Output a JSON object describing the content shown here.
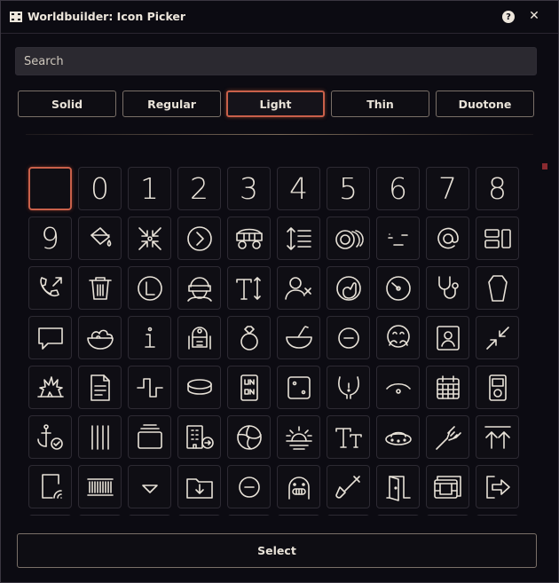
{
  "window": {
    "title": "Worldbuilder: Icon Picker",
    "help_label": "?",
    "close_label": "✕"
  },
  "search": {
    "placeholder": "Search",
    "value": ""
  },
  "tabs": [
    {
      "label": "Solid",
      "active": false
    },
    {
      "label": "Regular",
      "active": false
    },
    {
      "label": "Light",
      "active": true
    },
    {
      "label": "Thin",
      "active": false
    },
    {
      "label": "Duotone",
      "active": false
    }
  ],
  "icons": {
    "row1": [
      "blank",
      "0",
      "1",
      "2",
      "3",
      "4",
      "5",
      "6",
      "7",
      "8"
    ],
    "row2": [
      "9",
      "fill-drip-icon",
      "compress-icon",
      "circle-chevron-right-icon",
      "wagon-icon",
      "line-height-icon",
      "coins-icon",
      "face-unamused-icon",
      "at-icon",
      "objects-align-icon"
    ],
    "row3": [
      "phone-arrow-icon",
      "trash-can-icon",
      "circle-l-icon",
      "user-visor-icon",
      "text-size-icon",
      "user-xmark-icon",
      "face-hand-icon",
      "gauge-icon",
      "stethoscope-icon",
      "coffin-icon"
    ],
    "row4": [
      "message-icon",
      "bowl-salad-icon",
      "info-icon",
      "robot-astromech-icon",
      "ring-diamond-icon",
      "bowl-spoon-icon",
      "circle-minus-icon",
      "face-hug-icon",
      "portrait-icon",
      "arrows-minimize-icon"
    ],
    "row5": [
      "explosion-icon",
      "file-lines-icon",
      "wave-square-icon",
      "ring-icon",
      "uno-card-icon",
      "dice-two-icon",
      "bladder-icon",
      "eye-closed-icon",
      "calendar-days-icon",
      "ipod-icon"
    ],
    "row6": [
      "anchor-circle-check-icon",
      "lines-vertical-icon",
      "rectangle-history-icon",
      "building-arrow-icon",
      "volleyball-icon",
      "sunset-icon",
      "text-serif-icon",
      "ufo-icon",
      "fork-icon",
      "arrows-up-line-icon"
    ],
    "row7": [
      "mobile-signal-icon",
      "barcode-icon",
      "caret-down-icon",
      "folder-download-icon",
      "circle-minus-icon",
      "face-grimace-icon",
      "shovel-icon",
      "door-open-icon",
      "film-simple-icon",
      "arrow-right-from-bracket-icon"
    ]
  },
  "select_label": "Select",
  "accent_color": "#c9604a"
}
